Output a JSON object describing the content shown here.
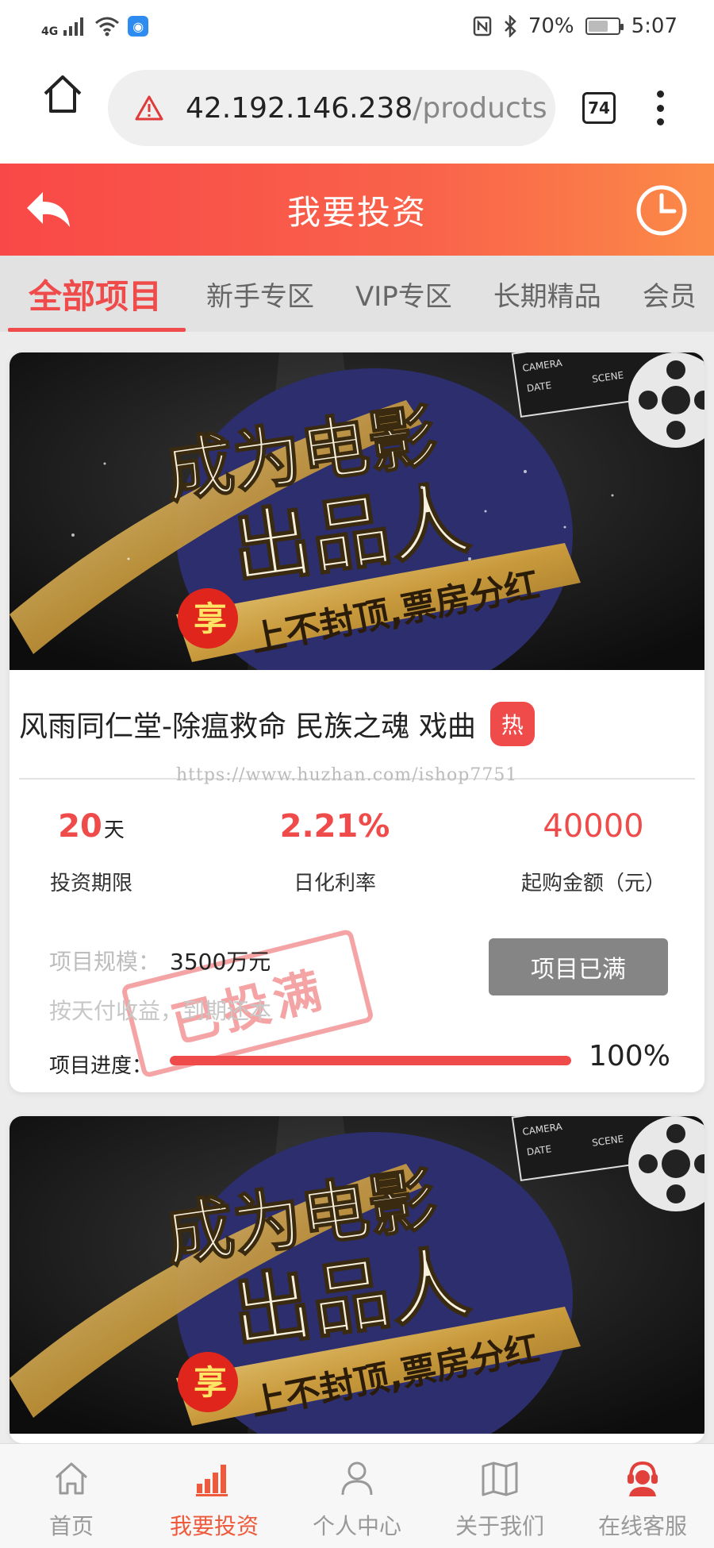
{
  "status_bar": {
    "network": "4G",
    "battery_pct": "70%",
    "battery_level": 0.7,
    "time": "5:07"
  },
  "browser": {
    "url_host": "42.192.146.238",
    "url_path": "/products",
    "tab_count": "74"
  },
  "header": {
    "title": "我要投资"
  },
  "tabs": [
    {
      "label": "全部项目",
      "active": true
    },
    {
      "label": "新手专区",
      "active": false
    },
    {
      "label": "VIP专区",
      "active": false
    },
    {
      "label": "长期精品",
      "active": false
    },
    {
      "label": "会员",
      "active": false
    }
  ],
  "banner": {
    "line1": "成为电影",
    "line2": "出品人",
    "badge": "享",
    "slogan": "上不封顶,票房分红",
    "clapper_text": [
      "CAMERA",
      "DATE",
      "SCENE"
    ]
  },
  "projects": [
    {
      "title": "风雨同仁堂-除瘟救命 民族之魂 戏曲",
      "hot_label": "热",
      "watermark": "https://www.huzhan.com/ishop7751",
      "term_value": "20",
      "term_unit": "天",
      "term_label": "投资期限",
      "rate_value": "2.21%",
      "rate_label": "日化利率",
      "min_amount": "40000",
      "min_label": "起购金额（元）",
      "scale_label": "项目规模：",
      "scale_value": "3500万元",
      "payment": "按天付收益，到期还本",
      "stamp": "已投满",
      "button_label": "项目已满",
      "progress_label": "项目进度：",
      "progress_text": "100%",
      "progress": 1.0
    }
  ],
  "bottom_nav": [
    {
      "label": "首页",
      "icon": "home-icon",
      "active": false
    },
    {
      "label": "我要投资",
      "icon": "bar-chart-icon",
      "active": true
    },
    {
      "label": "个人中心",
      "icon": "user-icon",
      "active": false
    },
    {
      "label": "关于我们",
      "icon": "book-icon",
      "active": false
    },
    {
      "label": "在线客服",
      "icon": "customer-service-icon",
      "active": false
    }
  ],
  "colors": {
    "accent": "#f04b4b",
    "header_start": "#f94848",
    "header_end": "#fb8b48",
    "nav_active": "#f05a3c"
  }
}
